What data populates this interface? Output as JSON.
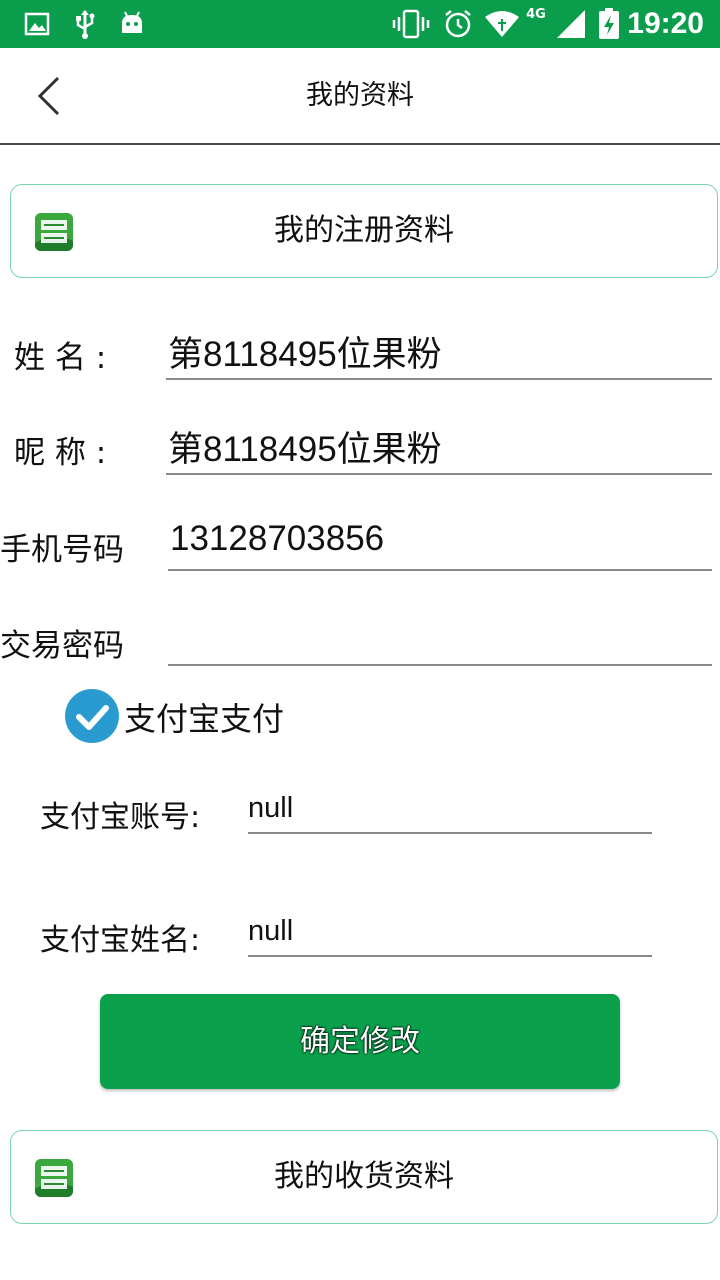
{
  "status_bar": {
    "time": "19:20",
    "network": "4G",
    "background_color": "#0a9d4c",
    "icons": [
      "image-icon",
      "usb-icon",
      "android-icon",
      "vibrate-icon",
      "alarm-icon",
      "wifi-icon",
      "signal-icon",
      "battery-charging-icon"
    ]
  },
  "nav": {
    "title": "我的资料",
    "back_icon": "chevron-left-icon"
  },
  "register_card": {
    "title": "我的注册资料",
    "logo_icon": "app-logo-icon"
  },
  "form": {
    "name": {
      "label": "姓 名 :",
      "value": "第8118495位果粉"
    },
    "nickname": {
      "label": "昵 称 :",
      "value": "第8118495位果粉"
    },
    "phone": {
      "label": "手机号码",
      "value": "13128703856"
    },
    "trade_password": {
      "label": "交易密码",
      "value": ""
    }
  },
  "alipay": {
    "checkbox_label": "支付宝支付",
    "checked": true,
    "account": {
      "label": "支付宝账号:",
      "value": "null"
    },
    "name": {
      "label": "支付宝姓名:",
      "value": "null"
    }
  },
  "confirm_button": {
    "label": "确定修改",
    "color": "#0aa04c"
  },
  "shipping_card": {
    "title": "我的收货资料",
    "logo_icon": "app-logo-icon"
  },
  "colors": {
    "brand_green": "#0a9d4c",
    "check_blue": "#2a9bd0",
    "card_border": "#7ad7ab"
  }
}
